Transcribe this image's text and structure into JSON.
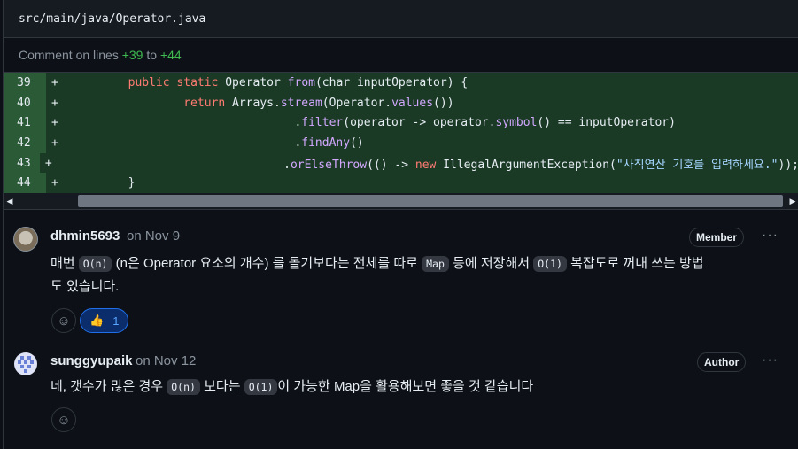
{
  "file": {
    "path": "src/main/java/Operator.java"
  },
  "comment_lines": {
    "prefix": "Comment on lines",
    "start": "+39",
    "to": "to",
    "end": "+44"
  },
  "code": [
    {
      "ln": "39",
      "sign": "+"
    },
    {
      "ln": "40",
      "sign": "+"
    },
    {
      "ln": "41",
      "sign": "+"
    },
    {
      "ln": "42",
      "sign": "+"
    },
    {
      "ln": "43",
      "sign": "+"
    },
    {
      "ln": "44",
      "sign": "+"
    }
  ],
  "code_tokens": {
    "l39": [
      "public",
      "static",
      "Operator",
      "from",
      "(char inputOperator) {"
    ],
    "l40": [
      "return",
      "Arrays.",
      "stream",
      "(Operator.",
      "values",
      "())"
    ],
    "l41": [
      ".",
      "filter",
      "(operator -> operator.",
      "symbol",
      "() == inputOperator)"
    ],
    "l42": [
      ".",
      "findAny",
      "()"
    ],
    "l43": [
      ".",
      "orElseThrow",
      "(() -> ",
      "new",
      "IllegalArgumentException(",
      "\"사칙연산 기호를 입력하세요.\"",
      "));"
    ],
    "l44": [
      "}"
    ]
  },
  "comments": [
    {
      "author": "dhmin5693",
      "date": "on Nov 9",
      "badge": "Member",
      "more": "···",
      "text": [
        "매번 ",
        "O(n)",
        " (n은 Operator 요소의 개수) 를 돌기보다는 전체를 따로 ",
        "Map",
        " 등에 저장해서 ",
        "O(1)",
        " 복잡도로 꺼내 쓰는 방법",
        "도 있습니다."
      ],
      "reaction": {
        "emoji": "👍",
        "count": "1"
      }
    },
    {
      "author": "sunggyupaik",
      "date": "on Nov 12",
      "badge": "Author",
      "more": "···",
      "text": [
        "네, 갯수가 많은 경우 ",
        "O(n)",
        " 보다는 ",
        "O(1)",
        "이 가능한 Map을 활용해보면 좋을 것 같습니다"
      ]
    }
  ],
  "icons": {
    "smiley": "smiley-icon",
    "scroll_left": "triangle-left-icon",
    "scroll_right": "triangle-right-icon"
  }
}
